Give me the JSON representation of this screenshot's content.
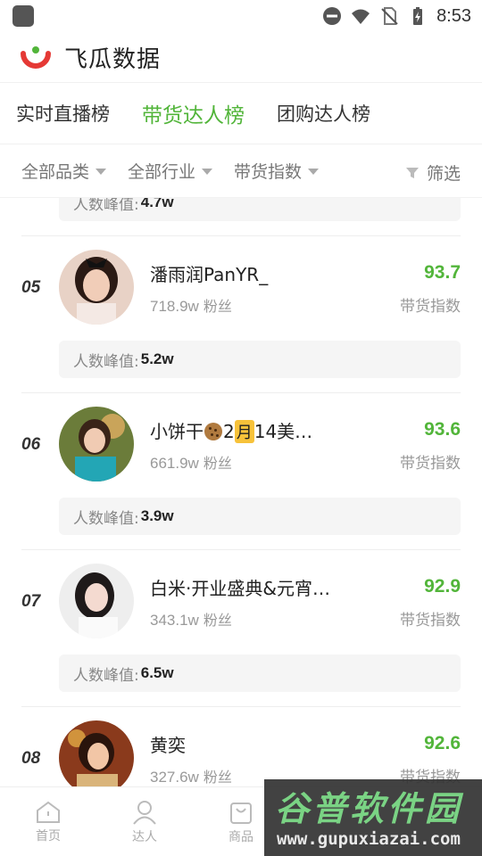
{
  "status_bar": {
    "time": "8:53"
  },
  "app": {
    "title": "飞瓜数据"
  },
  "main_tabs": [
    {
      "label": "实时直播榜",
      "active": false
    },
    {
      "label": "带货达人榜",
      "active": true
    },
    {
      "label": "团购达人榜",
      "active": false
    }
  ],
  "filters": {
    "category": "全部品类",
    "industry": "全部行业",
    "index": "带货指数",
    "screen": "筛选"
  },
  "list": {
    "peak_label": "人数峰值:",
    "fans_unit": "粉丝",
    "score_label": "带货指数",
    "partial_top_peak": "4.7w",
    "items": [
      {
        "rank": "05",
        "name": "潘雨润PanYR_",
        "fans": "718.9w",
        "score": "93.7",
        "peak": "5.2w"
      },
      {
        "rank": "06",
        "name_prefix": "小饼干",
        "name_mid": "2",
        "name_month": "月",
        "name_suffix": "14美…",
        "fans": "661.9w",
        "score": "93.6",
        "peak": "3.9w"
      },
      {
        "rank": "07",
        "name": "白米·开业盛典&元宵…",
        "fans": "343.1w",
        "score": "92.9",
        "peak": "6.5w"
      },
      {
        "rank": "08",
        "name": "黄奕",
        "fans": "327.6w",
        "score": "92.6"
      }
    ]
  },
  "bottom_nav": [
    {
      "label": "首页",
      "icon": "home-icon"
    },
    {
      "label": "达人",
      "icon": "person-icon"
    },
    {
      "label": "商品",
      "icon": "bag-icon"
    }
  ],
  "watermark": {
    "title": "谷普软件园",
    "url": "www.gupuxiazai.com"
  },
  "colors": {
    "accent": "#52b53a",
    "logo_red": "#e53935"
  }
}
